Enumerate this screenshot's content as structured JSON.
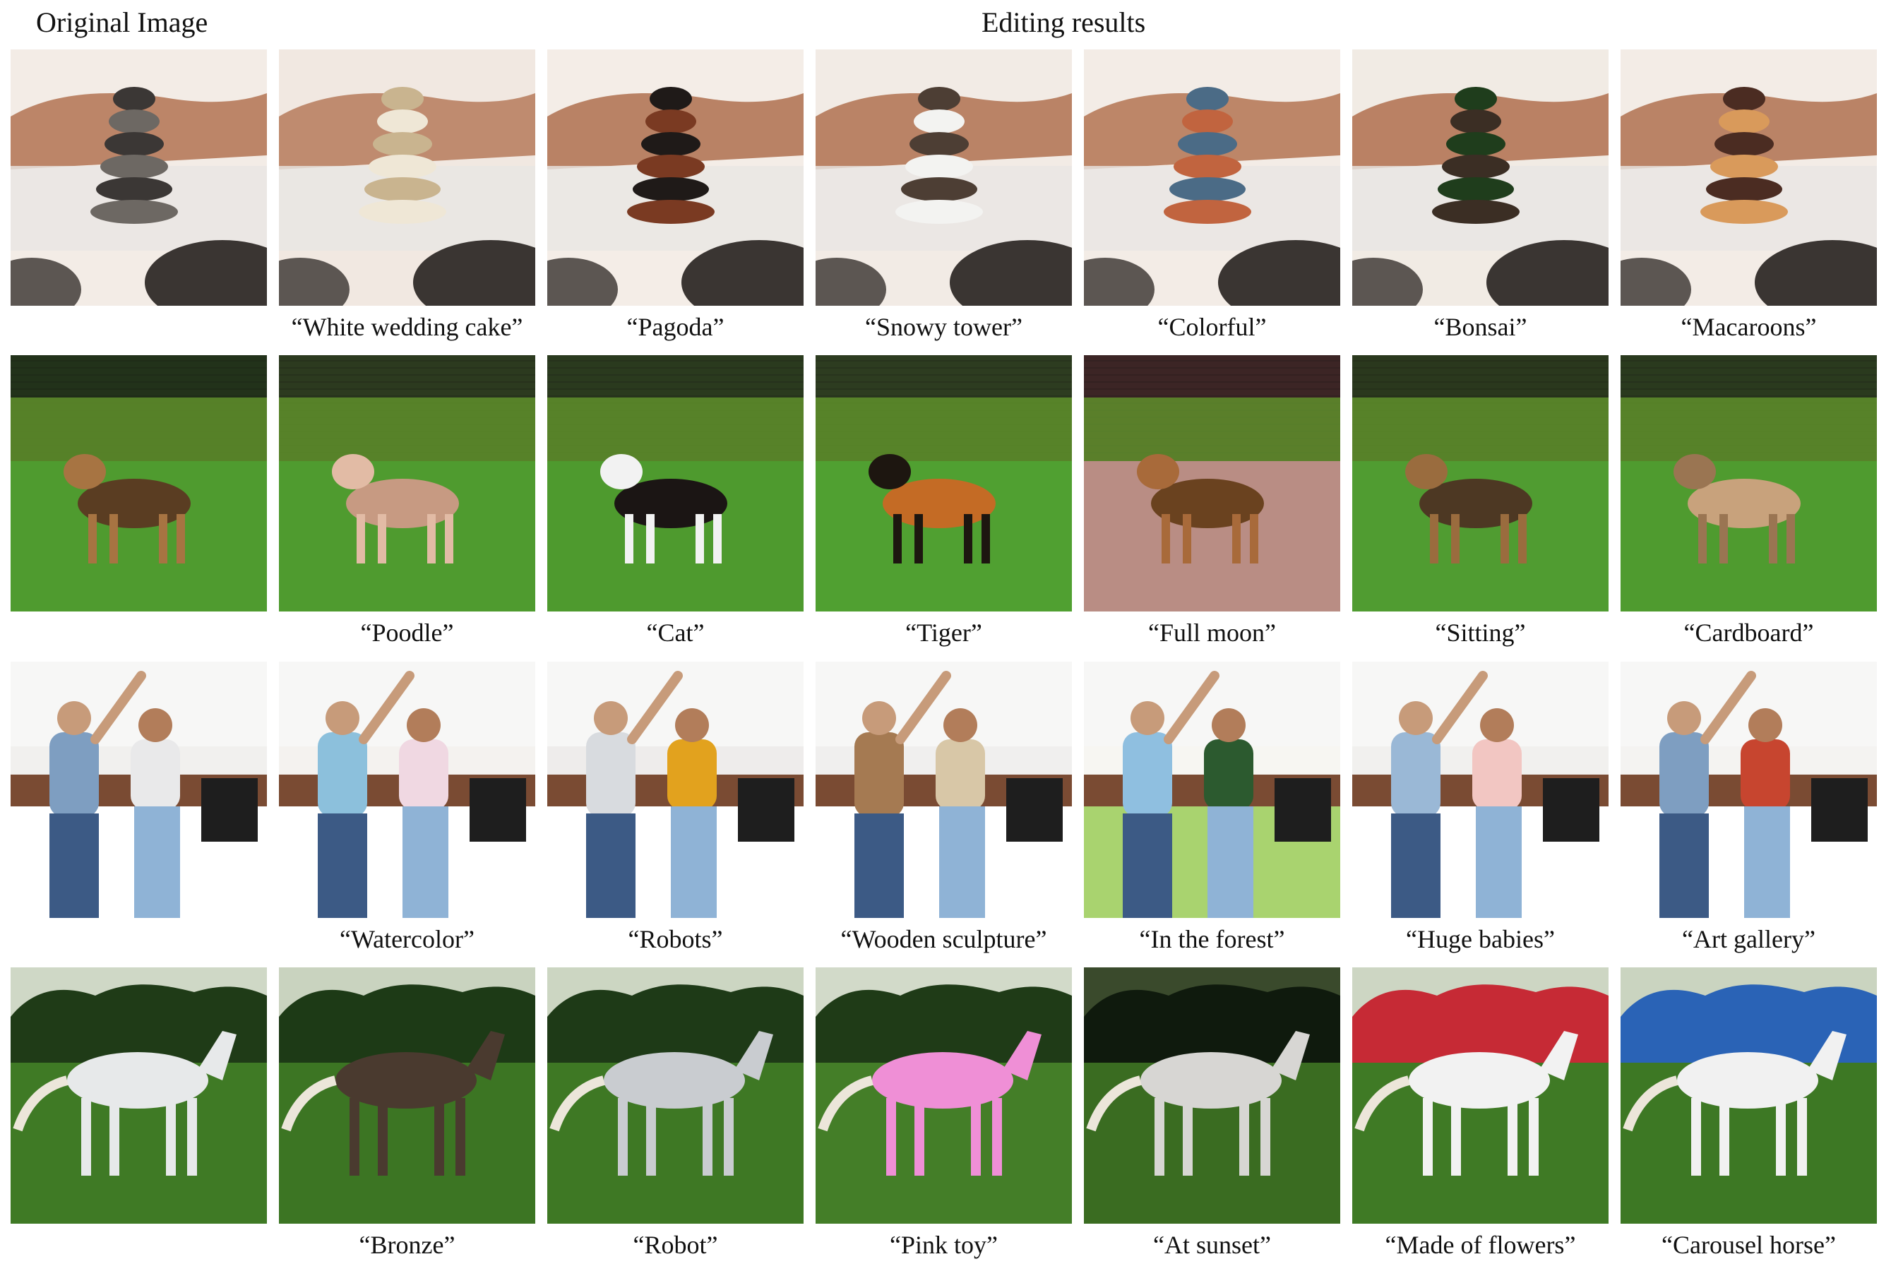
{
  "headers": {
    "original": "Original Image",
    "edited": "Editing results"
  },
  "rows": [
    {
      "name": "stacked-stones",
      "scene": "stones",
      "tiles": [
        {
          "caption": "",
          "subject": "stacked stones",
          "palette": {
            "sky": "#f3ece6",
            "ground": "#b67a5a",
            "subject": "#3b3735",
            "accent": "#6d6863"
          }
        },
        {
          "caption": "“White wedding cake”",
          "subject": "wedding cake",
          "palette": {
            "sky": "#f1e8e1",
            "ground": "#b98163",
            "subject": "#c9b48f",
            "accent": "#efe7d6"
          }
        },
        {
          "caption": "“Pagoda”",
          "subject": "pagoda",
          "palette": {
            "sky": "#f4ede7",
            "ground": "#b37656",
            "subject": "#1f1a18",
            "accent": "#7a3a22"
          }
        },
        {
          "caption": "“Snowy tower”",
          "subject": "snowy tower",
          "palette": {
            "sky": "#f2ebe5",
            "ground": "#b47858",
            "subject": "#4d3e34",
            "accent": "#f3f3f1"
          }
        },
        {
          "caption": "“Colorful”",
          "subject": "colorful stones",
          "palette": {
            "sky": "#f3ece6",
            "ground": "#b77b5a",
            "subject": "#4b6b86",
            "accent": "#c1643f"
          }
        },
        {
          "caption": "“Bonsai”",
          "subject": "bonsai",
          "palette": {
            "sky": "#f1ebe4",
            "ground": "#b47655",
            "subject": "#1f3d1c",
            "accent": "#3b2e24"
          }
        },
        {
          "caption": "“Macaroons”",
          "subject": "macaroons",
          "palette": {
            "sky": "#f3ece6",
            "ground": "#b47858",
            "subject": "#4b2c22",
            "accent": "#d99a5b"
          }
        }
      ]
    },
    {
      "name": "dog-on-grass",
      "scene": "lawn",
      "tiles": [
        {
          "caption": "",
          "subject": "german shepherd",
          "palette": {
            "sky": "#22321a",
            "ground": "#4f9b2f",
            "subject": "#5a3d22",
            "accent": "#a77442"
          }
        },
        {
          "caption": "“Poodle”",
          "subject": "poodle",
          "palette": {
            "sky": "#2c3a1f",
            "ground": "#4f9b2f",
            "subject": "#c79a82",
            "accent": "#e2bba5"
          }
        },
        {
          "caption": "“Cat”",
          "subject": "cat",
          "palette": {
            "sky": "#2a3a1e",
            "ground": "#4e9a2e",
            "subject": "#1b1514",
            "accent": "#f2f2f2"
          }
        },
        {
          "caption": "“Tiger”",
          "subject": "tiger",
          "palette": {
            "sky": "#2d3c20",
            "ground": "#50a031",
            "subject": "#c46b25",
            "accent": "#1d1610"
          }
        },
        {
          "caption": "“Full moon”",
          "subject": "dog under moon",
          "palette": {
            "sky": "#3c2525",
            "ground": "#b98d84",
            "subject": "#6a421f",
            "accent": "#a86a3a"
          }
        },
        {
          "caption": "“Sitting”",
          "subject": "lying dog",
          "palette": {
            "sky": "#2a381d",
            "ground": "#509c31",
            "subject": "#4d3823",
            "accent": "#9a6c3e"
          }
        },
        {
          "caption": "“Cardboard”",
          "subject": "cardboard dog",
          "palette": {
            "sky": "#2a3a1e",
            "ground": "#4f9b2f",
            "subject": "#c8a27c",
            "accent": "#9a7552"
          }
        }
      ]
    },
    {
      "name": "dancing-couple",
      "scene": "kitchen",
      "tiles": [
        {
          "caption": "",
          "subject": "couple dancing",
          "palette": {
            "sky": "#f1f0ee",
            "ground": "#ffffff",
            "subject": "#7e9ec1",
            "accent": "#e9e9ea"
          }
        },
        {
          "caption": "“Watercolor”",
          "subject": "watercolor couple",
          "palette": {
            "sky": "#f4f2ef",
            "ground": "#ffffff",
            "subject": "#8cc0dc",
            "accent": "#f0d8e2"
          }
        },
        {
          "caption": "“Robots”",
          "subject": "robots",
          "palette": {
            "sky": "#eeeceb",
            "ground": "#ffffff",
            "subject": "#d8dbdf",
            "accent": "#e2a21e"
          }
        },
        {
          "caption": "“Wooden sculpture”",
          "subject": "wooden sculpture",
          "palette": {
            "sky": "#f0efee",
            "ground": "#ffffff",
            "subject": "#a57a52",
            "accent": "#d8c7a7"
          }
        },
        {
          "caption": "“In the forest”",
          "subject": "couple in forest",
          "palette": {
            "sky": "#f7f6f2",
            "ground": "#a9d36f",
            "subject": "#8fbfe0",
            "accent": "#2c5a2f"
          }
        },
        {
          "caption": "“Huge babies”",
          "subject": "babies",
          "palette": {
            "sky": "#f1f0ee",
            "ground": "#ffffff",
            "subject": "#9ab8d6",
            "accent": "#f2c6c2"
          }
        },
        {
          "caption": "“Art gallery”",
          "subject": "couple in gallery",
          "palette": {
            "sky": "#f4f3f1",
            "ground": "#ffffff",
            "subject": "#7e9ec1",
            "accent": "#c7452f"
          }
        }
      ]
    },
    {
      "name": "horse-in-field",
      "scene": "field",
      "tiles": [
        {
          "caption": "",
          "subject": "white horse",
          "palette": {
            "sky": "#cfd8c6",
            "ground": "#3f7a25",
            "subject": "#e7e9ea",
            "accent": "#1f3b17"
          }
        },
        {
          "caption": "“Bronze”",
          "subject": "bronze horse",
          "palette": {
            "sky": "#c9d3bf",
            "ground": "#3c7523",
            "subject": "#4a3a2f",
            "accent": "#1d3a16"
          }
        },
        {
          "caption": "“Robot”",
          "subject": "robot horse",
          "palette": {
            "sky": "#ccd6c2",
            "ground": "#3e7824",
            "subject": "#c9ccd0",
            "accent": "#1e3a17"
          }
        },
        {
          "caption": "“Pink toy”",
          "subject": "pink toy horse",
          "palette": {
            "sky": "#d2dac9",
            "ground": "#447e28",
            "subject": "#ef8fd6",
            "accent": "#1f3b17"
          }
        },
        {
          "caption": "“At sunset”",
          "subject": "horse at sunset",
          "palette": {
            "sky": "#3a4a2c",
            "ground": "#3a6c21",
            "subject": "#d7d6d3",
            "accent": "#0f1a0d"
          }
        },
        {
          "caption": "“Made of flowers”",
          "subject": "flower horse",
          "palette": {
            "sky": "#cdd6c3",
            "ground": "#3f7a25",
            "subject": "#f2f2f2",
            "accent": "#c62a35"
          }
        },
        {
          "caption": "“Carousel horse”",
          "subject": "carousel horse",
          "palette": {
            "sky": "#cad4c0",
            "ground": "#3d7824",
            "subject": "#f1f1f1",
            "accent": "#2a63b6"
          }
        }
      ]
    }
  ]
}
